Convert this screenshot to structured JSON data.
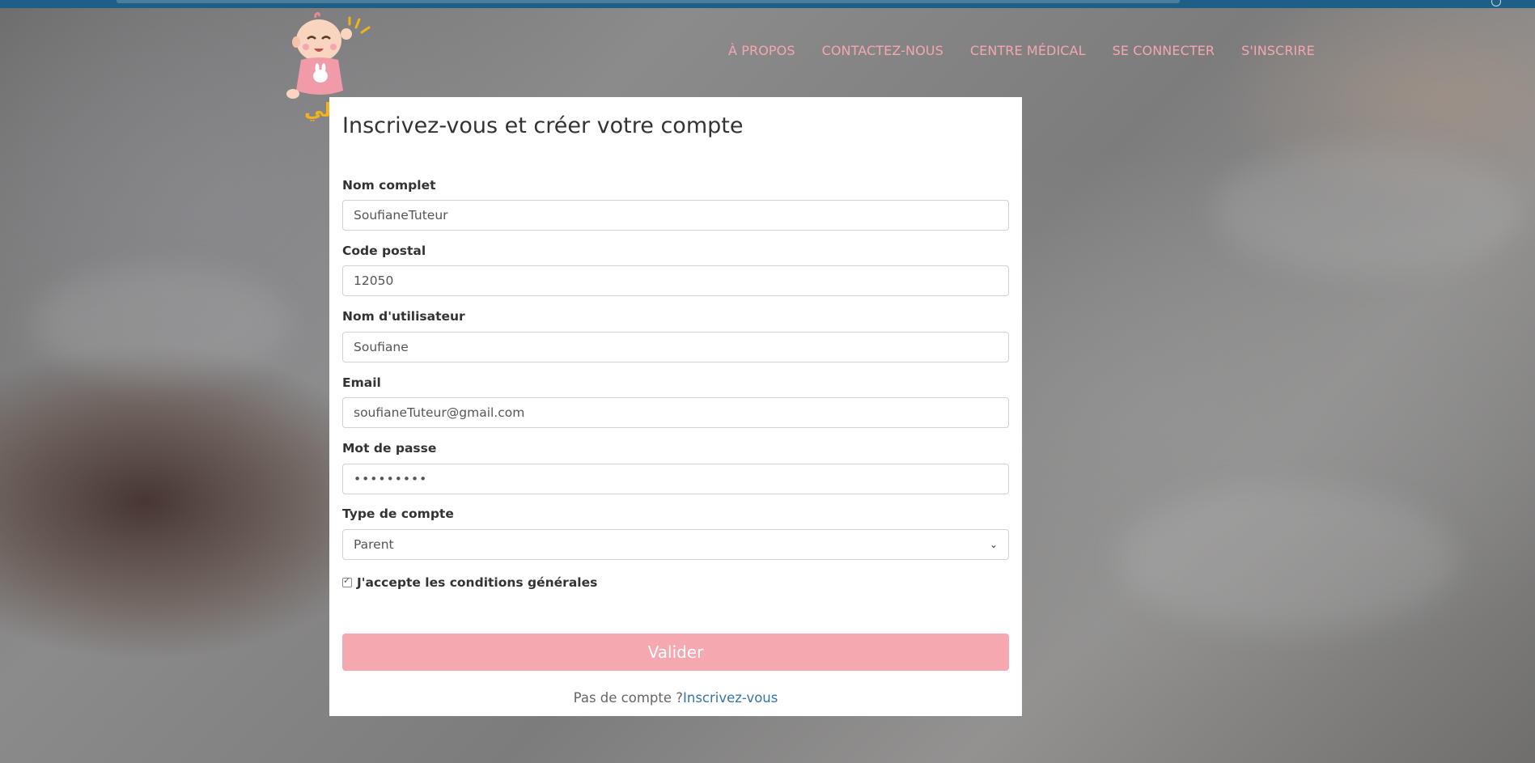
{
  "nav": {
    "items": [
      {
        "label": "À PROPOS"
      },
      {
        "label": "CONTACTEZ-NOUS"
      },
      {
        "label": "CENTRE MÉDICAL"
      },
      {
        "label": "SE CONNECTER"
      },
      {
        "label": "S'INSCRIRE"
      }
    ]
  },
  "brand": {
    "logo_text": "أطفالي",
    "colors": {
      "accent": "#f5a8af",
      "nav_text": "#f4a7b1",
      "link": "#3573a8",
      "topbar": "#1d5f86"
    }
  },
  "form": {
    "title": "Inscrivez-vous et créer votre compte",
    "fields": {
      "full_name": {
        "label": "Nom complet",
        "value": "SoufianeTuteur"
      },
      "postal_code": {
        "label": "Code postal",
        "value": "12050"
      },
      "username": {
        "label": "Nom d'utilisateur",
        "value": "Soufiane"
      },
      "email": {
        "label": "Email",
        "value": "soufianeTuteur@gmail.com"
      },
      "password": {
        "label": "Mot de passe",
        "value": "•••••••••"
      },
      "account_type": {
        "label": "Type de compte",
        "value": "Parent"
      }
    },
    "terms": {
      "label": "J'accepte les conditions générales",
      "checked": true
    },
    "submit_label": "Valider",
    "footer_text": "Pas de compte ?",
    "footer_link": "Inscrivez-vous"
  }
}
